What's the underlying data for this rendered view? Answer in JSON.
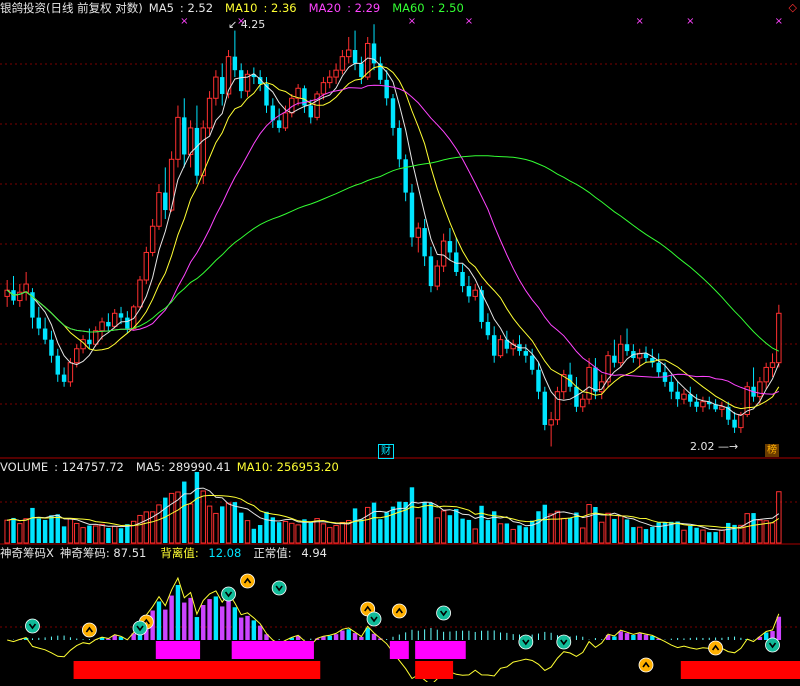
{
  "chart_data": {
    "type": "candlestick",
    "main_panel": {
      "title": "银鸽投资(日线 前复权 对数)",
      "indicators": [
        {
          "label": "MA5",
          "value": "2.52",
          "color": "#e6e6e6"
        },
        {
          "label": "MA10",
          "value": "2.36",
          "color": "#ffff33"
        },
        {
          "label": "MA20",
          "value": "2.29",
          "color": "#ff44ff"
        },
        {
          "label": "MA60",
          "value": "2.50",
          "color": "#33ff33"
        }
      ],
      "price_range": [
        1.95,
        4.35
      ],
      "log_scale": true,
      "annotations": [
        {
          "text": "4.25",
          "day": 36,
          "price": 4.25
        },
        {
          "text": "2.02",
          "day": 122,
          "price": 2.02
        }
      ],
      "event_marks": [
        {
          "text": "财",
          "day": 63
        },
        {
          "text": "榜",
          "day": 128
        }
      ],
      "candles": [
        {
          "o": 2.6,
          "h": 2.68,
          "l": 2.55,
          "c": 2.63
        },
        {
          "o": 2.63,
          "h": 2.7,
          "l": 2.56,
          "c": 2.58
        },
        {
          "o": 2.58,
          "h": 2.66,
          "l": 2.55,
          "c": 2.62
        },
        {
          "o": 2.62,
          "h": 2.72,
          "l": 2.58,
          "c": 2.66
        },
        {
          "o": 2.62,
          "h": 2.64,
          "l": 2.45,
          "c": 2.5
        },
        {
          "o": 2.5,
          "h": 2.55,
          "l": 2.42,
          "c": 2.45
        },
        {
          "o": 2.45,
          "h": 2.5,
          "l": 2.38,
          "c": 2.4
        },
        {
          "o": 2.4,
          "h": 2.44,
          "l": 2.3,
          "c": 2.33
        },
        {
          "o": 2.33,
          "h": 2.36,
          "l": 2.22,
          "c": 2.25
        },
        {
          "o": 2.25,
          "h": 2.28,
          "l": 2.2,
          "c": 2.22
        },
        {
          "o": 2.22,
          "h": 2.32,
          "l": 2.2,
          "c": 2.3
        },
        {
          "o": 2.3,
          "h": 2.38,
          "l": 2.28,
          "c": 2.36
        },
        {
          "o": 2.36,
          "h": 2.42,
          "l": 2.34,
          "c": 2.4
        },
        {
          "o": 2.4,
          "h": 2.45,
          "l": 2.36,
          "c": 2.38
        },
        {
          "o": 2.38,
          "h": 2.46,
          "l": 2.37,
          "c": 2.44
        },
        {
          "o": 2.44,
          "h": 2.5,
          "l": 2.4,
          "c": 2.48
        },
        {
          "o": 2.48,
          "h": 2.52,
          "l": 2.44,
          "c": 2.46
        },
        {
          "o": 2.46,
          "h": 2.54,
          "l": 2.45,
          "c": 2.52
        },
        {
          "o": 2.52,
          "h": 2.55,
          "l": 2.47,
          "c": 2.5
        },
        {
          "o": 2.5,
          "h": 2.53,
          "l": 2.43,
          "c": 2.45
        },
        {
          "o": 2.45,
          "h": 2.56,
          "l": 2.44,
          "c": 2.55
        },
        {
          "o": 2.55,
          "h": 2.7,
          "l": 2.54,
          "c": 2.68
        },
        {
          "o": 2.68,
          "h": 2.85,
          "l": 2.66,
          "c": 2.82
        },
        {
          "o": 2.82,
          "h": 3.0,
          "l": 2.8,
          "c": 2.96
        },
        {
          "o": 2.96,
          "h": 3.2,
          "l": 2.94,
          "c": 3.15
        },
        {
          "o": 3.15,
          "h": 3.3,
          "l": 3.0,
          "c": 3.05
        },
        {
          "o": 3.05,
          "h": 3.4,
          "l": 3.04,
          "c": 3.35
        },
        {
          "o": 3.35,
          "h": 3.7,
          "l": 3.3,
          "c": 3.62
        },
        {
          "o": 3.62,
          "h": 3.75,
          "l": 3.3,
          "c": 3.38
        },
        {
          "o": 3.38,
          "h": 3.6,
          "l": 3.3,
          "c": 3.55
        },
        {
          "o": 3.55,
          "h": 3.7,
          "l": 3.2,
          "c": 3.25
        },
        {
          "o": 3.25,
          "h": 3.6,
          "l": 3.2,
          "c": 3.55
        },
        {
          "o": 3.55,
          "h": 3.8,
          "l": 3.5,
          "c": 3.75
        },
        {
          "o": 3.75,
          "h": 3.95,
          "l": 3.7,
          "c": 3.9
        },
        {
          "o": 3.9,
          "h": 4.0,
          "l": 3.7,
          "c": 3.78
        },
        {
          "o": 3.78,
          "h": 4.1,
          "l": 3.75,
          "c": 4.05
        },
        {
          "o": 4.05,
          "h": 4.25,
          "l": 3.9,
          "c": 3.95
        },
        {
          "o": 3.95,
          "h": 4.0,
          "l": 3.75,
          "c": 3.8
        },
        {
          "o": 3.8,
          "h": 3.95,
          "l": 3.76,
          "c": 3.92
        },
        {
          "o": 3.92,
          "h": 3.97,
          "l": 3.85,
          "c": 3.9
        },
        {
          "o": 3.9,
          "h": 3.95,
          "l": 3.8,
          "c": 3.85
        },
        {
          "o": 3.85,
          "h": 3.9,
          "l": 3.65,
          "c": 3.7
        },
        {
          "o": 3.7,
          "h": 3.75,
          "l": 3.55,
          "c": 3.6
        },
        {
          "o": 3.6,
          "h": 3.68,
          "l": 3.52,
          "c": 3.55
        },
        {
          "o": 3.55,
          "h": 3.7,
          "l": 3.53,
          "c": 3.65
        },
        {
          "o": 3.65,
          "h": 3.78,
          "l": 3.62,
          "c": 3.75
        },
        {
          "o": 3.75,
          "h": 3.85,
          "l": 3.7,
          "c": 3.82
        },
        {
          "o": 3.82,
          "h": 3.84,
          "l": 3.65,
          "c": 3.7
        },
        {
          "o": 3.7,
          "h": 3.74,
          "l": 3.58,
          "c": 3.62
        },
        {
          "o": 3.62,
          "h": 3.8,
          "l": 3.6,
          "c": 3.78
        },
        {
          "o": 3.78,
          "h": 3.9,
          "l": 3.74,
          "c": 3.86
        },
        {
          "o": 3.86,
          "h": 3.95,
          "l": 3.82,
          "c": 3.9
        },
        {
          "o": 3.9,
          "h": 4.0,
          "l": 3.85,
          "c": 3.95
        },
        {
          "o": 3.95,
          "h": 4.1,
          "l": 3.92,
          "c": 4.05
        },
        {
          "o": 4.05,
          "h": 4.2,
          "l": 4.0,
          "c": 4.1
        },
        {
          "o": 4.1,
          "h": 4.25,
          "l": 3.95,
          "c": 4.0
        },
        {
          "o": 4.0,
          "h": 4.05,
          "l": 3.85,
          "c": 3.9
        },
        {
          "o": 3.9,
          "h": 4.2,
          "l": 3.88,
          "c": 4.15
        },
        {
          "o": 4.15,
          "h": 4.3,
          "l": 3.95,
          "c": 4.0
        },
        {
          "o": 4.0,
          "h": 4.05,
          "l": 3.85,
          "c": 3.88
        },
        {
          "o": 3.88,
          "h": 3.95,
          "l": 3.7,
          "c": 3.75
        },
        {
          "o": 3.75,
          "h": 3.78,
          "l": 3.5,
          "c": 3.55
        },
        {
          "o": 3.55,
          "h": 3.6,
          "l": 3.3,
          "c": 3.35
        },
        {
          "o": 3.35,
          "h": 3.38,
          "l": 3.1,
          "c": 3.15
        },
        {
          "o": 3.15,
          "h": 3.2,
          "l": 2.85,
          "c": 2.9
        },
        {
          "o": 2.9,
          "h": 2.98,
          "l": 2.82,
          "c": 2.95
        },
        {
          "o": 2.95,
          "h": 3.0,
          "l": 2.75,
          "c": 2.8
        },
        {
          "o": 2.8,
          "h": 2.85,
          "l": 2.62,
          "c": 2.65
        },
        {
          "o": 2.65,
          "h": 2.78,
          "l": 2.63,
          "c": 2.75
        },
        {
          "o": 2.75,
          "h": 2.92,
          "l": 2.72,
          "c": 2.88
        },
        {
          "o": 2.88,
          "h": 2.95,
          "l": 2.78,
          "c": 2.82
        },
        {
          "o": 2.82,
          "h": 2.9,
          "l": 2.7,
          "c": 2.72
        },
        {
          "o": 2.72,
          "h": 2.76,
          "l": 2.62,
          "c": 2.65
        },
        {
          "o": 2.65,
          "h": 2.7,
          "l": 2.57,
          "c": 2.6
        },
        {
          "o": 2.6,
          "h": 2.66,
          "l": 2.58,
          "c": 2.63
        },
        {
          "o": 2.63,
          "h": 2.65,
          "l": 2.45,
          "c": 2.48
        },
        {
          "o": 2.48,
          "h": 2.52,
          "l": 2.4,
          "c": 2.42
        },
        {
          "o": 2.42,
          "h": 2.46,
          "l": 2.3,
          "c": 2.33
        },
        {
          "o": 2.33,
          "h": 2.42,
          "l": 2.32,
          "c": 2.4
        },
        {
          "o": 2.4,
          "h": 2.44,
          "l": 2.34,
          "c": 2.36
        },
        {
          "o": 2.36,
          "h": 2.4,
          "l": 2.33,
          "c": 2.38
        },
        {
          "o": 2.38,
          "h": 2.42,
          "l": 2.33,
          "c": 2.35
        },
        {
          "o": 2.35,
          "h": 2.38,
          "l": 2.3,
          "c": 2.33
        },
        {
          "o": 2.33,
          "h": 2.36,
          "l": 2.25,
          "c": 2.27
        },
        {
          "o": 2.27,
          "h": 2.3,
          "l": 2.15,
          "c": 2.18
        },
        {
          "o": 2.18,
          "h": 2.2,
          "l": 2.03,
          "c": 2.05
        },
        {
          "o": 2.05,
          "h": 2.1,
          "l": 1.97,
          "c": 2.07
        },
        {
          "o": 2.07,
          "h": 2.2,
          "l": 2.05,
          "c": 2.18
        },
        {
          "o": 2.18,
          "h": 2.27,
          "l": 2.15,
          "c": 2.25
        },
        {
          "o": 2.25,
          "h": 2.3,
          "l": 2.18,
          "c": 2.2
        },
        {
          "o": 2.2,
          "h": 2.24,
          "l": 2.1,
          "c": 2.12
        },
        {
          "o": 2.12,
          "h": 2.17,
          "l": 2.1,
          "c": 2.15
        },
        {
          "o": 2.15,
          "h": 2.32,
          "l": 2.13,
          "c": 2.28
        },
        {
          "o": 2.28,
          "h": 2.32,
          "l": 2.15,
          "c": 2.18
        },
        {
          "o": 2.18,
          "h": 2.25,
          "l": 2.15,
          "c": 2.22
        },
        {
          "o": 2.22,
          "h": 2.35,
          "l": 2.2,
          "c": 2.33
        },
        {
          "o": 2.33,
          "h": 2.4,
          "l": 2.28,
          "c": 2.3
        },
        {
          "o": 2.3,
          "h": 2.42,
          "l": 2.28,
          "c": 2.38
        },
        {
          "o": 2.38,
          "h": 2.45,
          "l": 2.33,
          "c": 2.35
        },
        {
          "o": 2.35,
          "h": 2.38,
          "l": 2.3,
          "c": 2.32
        },
        {
          "o": 2.32,
          "h": 2.36,
          "l": 2.28,
          "c": 2.34
        },
        {
          "o": 2.34,
          "h": 2.37,
          "l": 2.3,
          "c": 2.32
        },
        {
          "o": 2.32,
          "h": 2.36,
          "l": 2.28,
          "c": 2.3
        },
        {
          "o": 2.3,
          "h": 2.34,
          "l": 2.24,
          "c": 2.26
        },
        {
          "o": 2.26,
          "h": 2.3,
          "l": 2.2,
          "c": 2.22
        },
        {
          "o": 2.22,
          "h": 2.25,
          "l": 2.15,
          "c": 2.18
        },
        {
          "o": 2.18,
          "h": 2.22,
          "l": 2.12,
          "c": 2.15
        },
        {
          "o": 2.15,
          "h": 2.19,
          "l": 2.13,
          "c": 2.17
        },
        {
          "o": 2.17,
          "h": 2.2,
          "l": 2.12,
          "c": 2.14
        },
        {
          "o": 2.14,
          "h": 2.17,
          "l": 2.1,
          "c": 2.12
        },
        {
          "o": 2.12,
          "h": 2.16,
          "l": 2.1,
          "c": 2.14
        },
        {
          "o": 2.14,
          "h": 2.16,
          "l": 2.11,
          "c": 2.13
        },
        {
          "o": 2.13,
          "h": 2.15,
          "l": 2.1,
          "c": 2.11
        },
        {
          "o": 2.11,
          "h": 2.14,
          "l": 2.08,
          "c": 2.12
        },
        {
          "o": 2.12,
          "h": 2.14,
          "l": 2.05,
          "c": 2.07
        },
        {
          "o": 2.07,
          "h": 2.1,
          "l": 2.02,
          "c": 2.04
        },
        {
          "o": 2.04,
          "h": 2.1,
          "l": 2.02,
          "c": 2.09
        },
        {
          "o": 2.09,
          "h": 2.22,
          "l": 2.08,
          "c": 2.2
        },
        {
          "o": 2.2,
          "h": 2.28,
          "l": 2.14,
          "c": 2.16
        },
        {
          "o": 2.16,
          "h": 2.24,
          "l": 2.13,
          "c": 2.22
        },
        {
          "o": 2.22,
          "h": 2.3,
          "l": 2.19,
          "c": 2.28
        },
        {
          "o": 2.28,
          "h": 2.34,
          "l": 2.24,
          "c": 2.3
        },
        {
          "o": 2.3,
          "h": 2.56,
          "l": 2.28,
          "c": 2.52
        }
      ]
    },
    "volume_panel": {
      "label": "VOLUME",
      "value": "124757.72",
      "ma5": "MA5: 289990.41",
      "ma10": "MA10: 256953.20",
      "scale_max": 520000
    },
    "indicator_panel": {
      "name": "神奇筹码X",
      "line_label": "神奇筹码: 87.51",
      "deviation_label": "背离值:",
      "deviation_value": "12.08",
      "normal_label": "正常值:",
      "normal_value": "4.94"
    }
  }
}
